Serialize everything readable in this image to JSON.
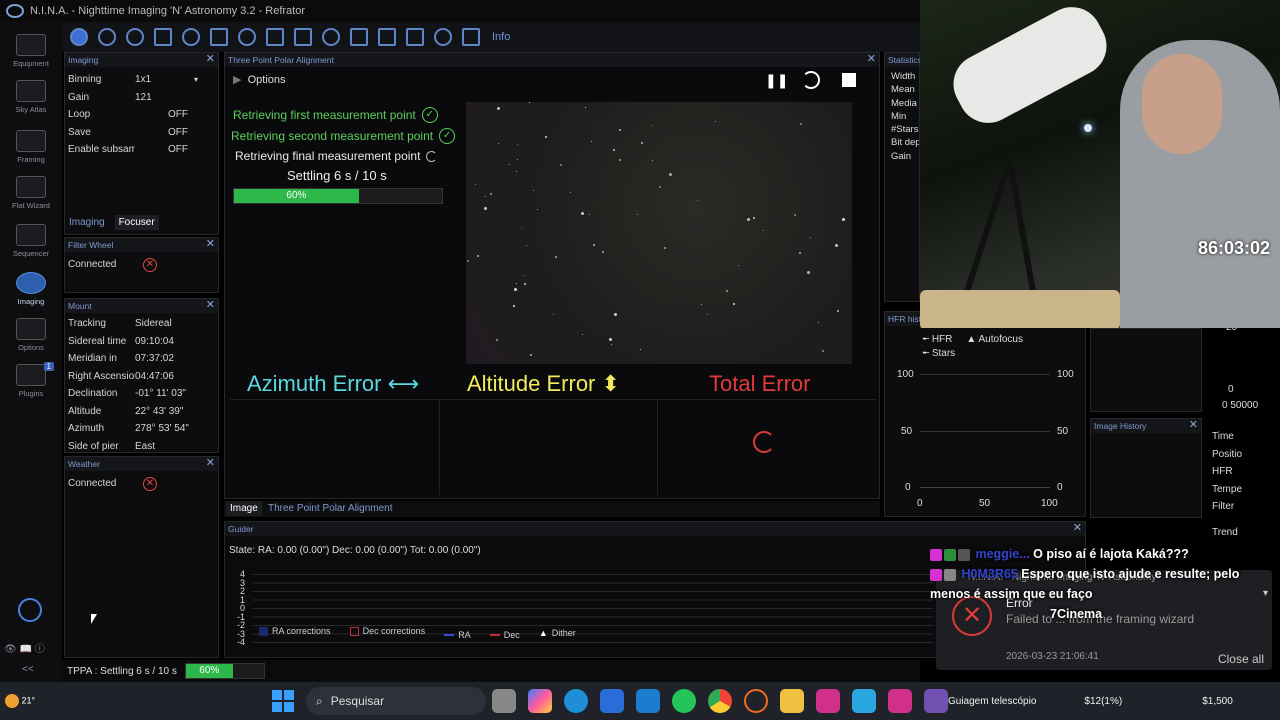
{
  "window": {
    "title": "N.I.N.A. - Nighttime Imaging 'N' Astronomy 3.2  -  Refrator"
  },
  "nav": [
    {
      "label": "Equipment",
      "icon": "camera-icon"
    },
    {
      "label": "Sky Atlas",
      "icon": "sky-atlas-icon"
    },
    {
      "label": "Framing",
      "icon": "framing-icon"
    },
    {
      "label": "Flat Wizard",
      "icon": "flat-wizard-icon"
    },
    {
      "label": "Sequencer",
      "icon": "sequencer-icon"
    },
    {
      "label": "Imaging",
      "icon": "imaging-icon"
    },
    {
      "label": "Options",
      "icon": "gear-icon"
    },
    {
      "label": "Plugins",
      "icon": "puzzle-icon",
      "badge": "1"
    }
  ],
  "toolbar": {
    "info_label": "Info"
  },
  "imaging_panel": {
    "title": "Imaging",
    "rows": [
      {
        "k": "Binning",
        "v": "1x1"
      },
      {
        "k": "Gain",
        "v": "121"
      },
      {
        "k": "Loop",
        "v": "OFF"
      },
      {
        "k": "Save",
        "v": "OFF"
      },
      {
        "k": "Enable subsam",
        "v": "OFF"
      }
    ],
    "tabs": [
      "Imaging",
      "Focuser"
    ]
  },
  "filter_wheel": {
    "title": "Filter Wheel",
    "connected_label": "Connected"
  },
  "mount": {
    "title": "Mount",
    "rows": [
      {
        "k": "Tracking",
        "v": "Sidereal"
      },
      {
        "k": "Sidereal time",
        "v": "09:10:04"
      },
      {
        "k": "Meridian in",
        "v": "07:37:02"
      },
      {
        "k": "Right Ascension",
        "v": "04:47:06"
      },
      {
        "k": "Declination",
        "v": "-01° 11' 03\""
      },
      {
        "k": "Altitude",
        "v": "22° 43' 39\""
      },
      {
        "k": "Azimuth",
        "v": "278° 53' 54\""
      },
      {
        "k": "Side of pier",
        "v": "East"
      }
    ]
  },
  "weather": {
    "title": "Weather",
    "connected_label": "Connected"
  },
  "tppa": {
    "title": "Three Point Polar Alignment",
    "options_label": "Options",
    "steps": [
      {
        "label": "Retrieving first measurement point",
        "state": "done"
      },
      {
        "label": "Retrieving second measurement point",
        "state": "done"
      },
      {
        "label": "Retrieving final measurement point",
        "state": "busy"
      }
    ],
    "settling_label": "Settling 6 s / 10 s",
    "progress": 0.6,
    "progress_label": "60%",
    "azimuth_label": "Azimuth Error ⟷",
    "altitude_label": "Altitude Error ⬍",
    "total_label": "Total Error"
  },
  "center_tabs": [
    "Image",
    "Three Point Polar Alignment"
  ],
  "statistics": {
    "title": "Statistics",
    "rows": [
      "Width",
      "Mean",
      "Media",
      "Min",
      "#Stars",
      "Bit dep",
      "Gain"
    ]
  },
  "hfr_history": {
    "title": "HFR histo",
    "legend": [
      "HFR",
      "Autofocus",
      "Stars"
    ],
    "y_ticks": [
      "100",
      "50",
      "0"
    ],
    "x_ticks": [
      "0",
      "50",
      "100"
    ]
  },
  "image_history": {
    "title": "Image History",
    "rows": [
      "Time",
      "Positio",
      "HFR",
      "Tempe",
      "Filter",
      "Trend"
    ]
  },
  "right_axis": {
    "ticks": [
      "20",
      "0"
    ],
    "x_ticks": "0 50000"
  },
  "guider": {
    "title": "Guider",
    "state_label": "State:  RA: 0.00 (0.00\")  Dec: 0.00 (0.00\")  Tot: 0.00 (0.00\")",
    "y_ticks": [
      "4",
      "3",
      "2",
      "1",
      "0",
      "-1",
      "-2",
      "-3",
      "-4"
    ],
    "legend": [
      "RA corrections",
      "Dec corrections",
      "RA",
      "Dec",
      "Dither"
    ]
  },
  "status_bar": {
    "label": "TPPA :  Settling 6 s / 10 s",
    "progress": 0.6,
    "progress_label": "60%"
  },
  "webcam": {
    "timer": "86:03:02"
  },
  "chat": {
    "lines": [
      {
        "user": "meggie...",
        "msg": "O piso aí é lajota Kaká???"
      },
      {
        "user": "H0M3R65",
        "msg": "Espero que isto ajude e resulte; pelo menos é assim que eu faço"
      },
      {
        "user": "",
        "msg": "7Cinema"
      }
    ]
  },
  "toast": {
    "bg_title": "N.I.N.A. - Nighttime Imaging 'N' Astronomy",
    "title": "Error",
    "message": "Failed to ... from the framing wizard",
    "timestamp": "2026-03-23 21:06:41",
    "close_all": "Close all"
  },
  "taskbar": {
    "search_placeholder": "Pesquisar",
    "weather_temp": "21°",
    "notification": "Guiagem telescópio",
    "price1": "$12(1%)",
    "price2": "$1,500"
  },
  "colors": {
    "accent": "#3c6fd1",
    "ok_green": "#5bd15b",
    "progress_green": "#2fb84a",
    "azimuth": "#5ad7df",
    "altitude": "#f2ec5c",
    "total": "#e03a3a"
  }
}
